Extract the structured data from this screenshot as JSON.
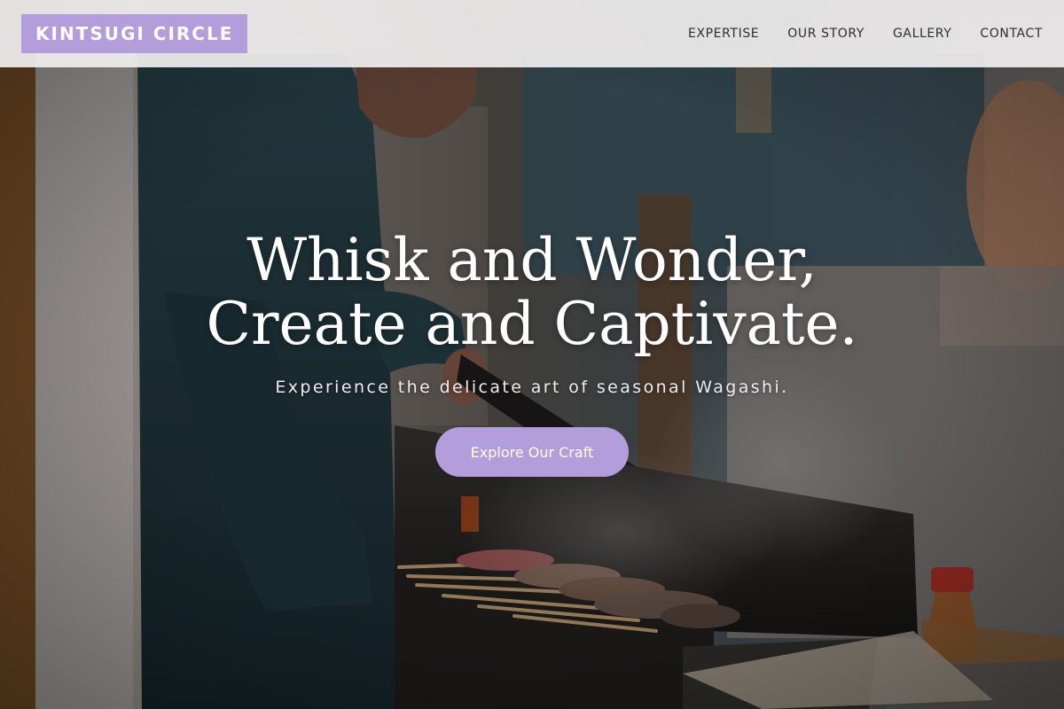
{
  "header": {
    "brand": "KINTSUGI CIRCLE",
    "nav": [
      {
        "label": "EXPERTISE"
      },
      {
        "label": "OUR STORY"
      },
      {
        "label": "GALLERY"
      },
      {
        "label": "CONTACT"
      }
    ]
  },
  "hero": {
    "headline_line1": "Whisk and Wonder,",
    "headline_line2": "Create and Captivate.",
    "subheadline": "Experience the delicate art of seasonal Wagashi.",
    "cta_label": "Explore Our Craft",
    "background_image": "chef-grilling-skewers-photo"
  },
  "colors": {
    "accent": "#b39ddb",
    "header_bg": "#f0eeee",
    "nav_text": "#2d2d33",
    "hero_text": "#ffffff"
  }
}
